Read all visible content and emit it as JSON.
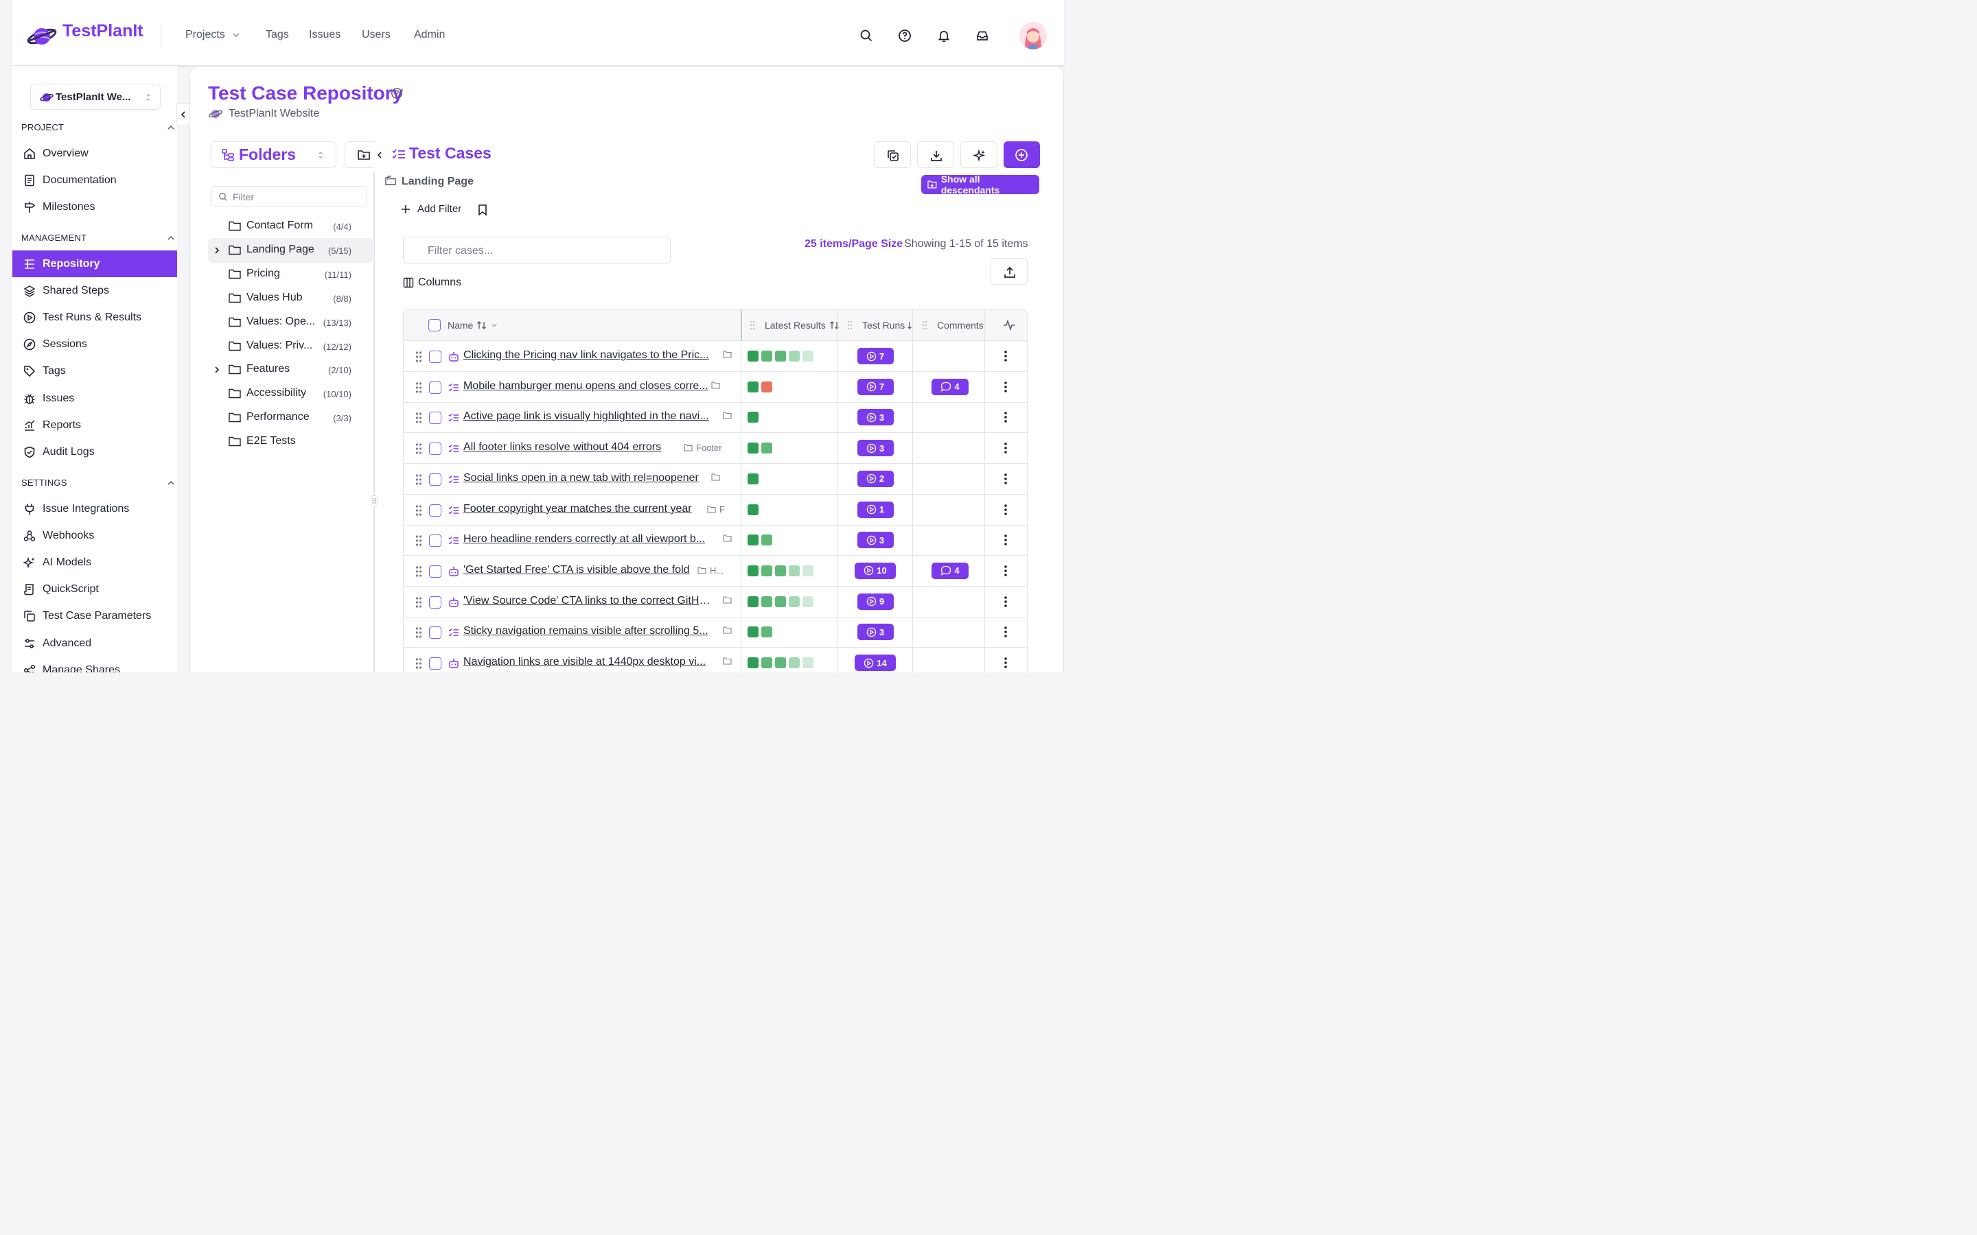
{
  "app": {
    "name": "TestPlanIt",
    "nav": [
      "Projects",
      "Tags",
      "Issues",
      "Users",
      "Admin"
    ]
  },
  "sidebar": {
    "project_select": "TestPlanIt We...",
    "sections": [
      {
        "title": "PROJECT",
        "items": [
          "Overview",
          "Documentation",
          "Milestones"
        ]
      },
      {
        "title": "MANAGEMENT",
        "items": [
          "Repository",
          "Shared Steps",
          "Test Runs & Results",
          "Sessions",
          "Tags",
          "Issues",
          "Reports",
          "Audit Logs"
        ]
      },
      {
        "title": "SETTINGS",
        "items": [
          "Issue Integrations",
          "Webhooks",
          "AI Models",
          "QuickScript",
          "Test Case Parameters",
          "Advanced",
          "Manage Shares"
        ]
      }
    ],
    "active_item": "Repository"
  },
  "page": {
    "title": "Test Case Repository",
    "project": "TestPlanIt Website"
  },
  "folders": {
    "title": "Folders",
    "filter_placeholder": "Filter",
    "items": [
      {
        "name": "Contact Form",
        "count": "(4/4)",
        "expandable": false
      },
      {
        "name": "Landing Page",
        "count": "(5/15)",
        "expandable": true,
        "selected": true
      },
      {
        "name": "Pricing",
        "count": "(11/11)",
        "expandable": false
      },
      {
        "name": "Values Hub",
        "count": "(8/8)",
        "expandable": false
      },
      {
        "name": "Values: Ope...",
        "count": "(13/13)",
        "expandable": false
      },
      {
        "name": "Values: Priv...",
        "count": "(12/12)",
        "expandable": false
      },
      {
        "name": "Features",
        "count": "(2/10)",
        "expandable": true
      },
      {
        "name": "Accessibility",
        "count": "(10/10)",
        "expandable": false
      },
      {
        "name": "Performance",
        "count": "(3/3)",
        "expandable": false
      },
      {
        "name": "E2E Tests",
        "count": "",
        "expandable": false
      }
    ]
  },
  "cases": {
    "title": "Test Cases",
    "breadcrumb": "Landing Page",
    "show_descendants": "Show all descendants",
    "add_filter": "Add Filter",
    "filter_placeholder": "Filter cases...",
    "page_size": "25 items/Page Size",
    "showing": "Showing 1-15 of 15 items",
    "columns_label": "Columns",
    "headers": {
      "name": "Name",
      "latest_results": "Latest Results",
      "test_runs": "Test Runs",
      "comments": "Comments"
    },
    "colors": {
      "pass_dark": "#2f9e55",
      "pass_mid": "#5fb878",
      "pass_light": "#a7d8b6",
      "pass_faint": "#cfead7",
      "fail": "#e8735f"
    },
    "rows": [
      {
        "type": "auto",
        "name": "Clicking the Pricing nav link navigates to the Pric...",
        "folder": "",
        "results": [
          "pass_dark",
          "pass_mid",
          "pass_mid",
          "pass_light",
          "pass_faint"
        ],
        "runs": "7",
        "comments": ""
      },
      {
        "type": "manual",
        "name": "Mobile hamburger menu opens and closes corre...",
        "folder": "",
        "results": [
          "pass_dark",
          "fail"
        ],
        "runs": "7",
        "comments": "4"
      },
      {
        "type": "manual",
        "name": "Active page link is visually highlighted in the navi...",
        "folder": "",
        "results": [
          "pass_dark"
        ],
        "runs": "3",
        "comments": ""
      },
      {
        "type": "manual",
        "name": "All footer links resolve without 404 errors",
        "folder": "Footer",
        "results": [
          "pass_dark",
          "pass_mid"
        ],
        "runs": "3",
        "comments": ""
      },
      {
        "type": "manual",
        "name": "Social links open in a new tab with rel=noopener",
        "folder": "",
        "results": [
          "pass_dark"
        ],
        "runs": "2",
        "comments": ""
      },
      {
        "type": "manual",
        "name": "Footer copyright year matches the current year",
        "folder": "F",
        "results": [
          "pass_dark"
        ],
        "runs": "1",
        "comments": ""
      },
      {
        "type": "manual",
        "name": "Hero headline renders correctly at all viewport b...",
        "folder": "",
        "results": [
          "pass_dark",
          "pass_mid"
        ],
        "runs": "3",
        "comments": ""
      },
      {
        "type": "auto",
        "name": "'Get Started Free' CTA is visible above the fold",
        "folder": "H...",
        "results": [
          "pass_dark",
          "pass_mid",
          "pass_mid",
          "pass_light",
          "pass_faint"
        ],
        "runs": "10",
        "comments": "4"
      },
      {
        "type": "auto",
        "name": "'View Source Code' CTA links to the correct GitHu...",
        "folder": "",
        "results": [
          "pass_dark",
          "pass_mid",
          "pass_mid",
          "pass_light",
          "pass_faint"
        ],
        "runs": "9",
        "comments": ""
      },
      {
        "type": "manual",
        "name": "Sticky navigation remains visible after scrolling 5...",
        "folder": "",
        "results": [
          "pass_dark",
          "pass_mid"
        ],
        "runs": "3",
        "comments": ""
      },
      {
        "type": "auto",
        "name": "Navigation links are visible at 1440px desktop vi...",
        "folder": "",
        "results": [
          "pass_dark",
          "pass_mid",
          "pass_mid",
          "pass_light",
          "pass_faint"
        ],
        "runs": "14",
        "comments": ""
      }
    ]
  }
}
